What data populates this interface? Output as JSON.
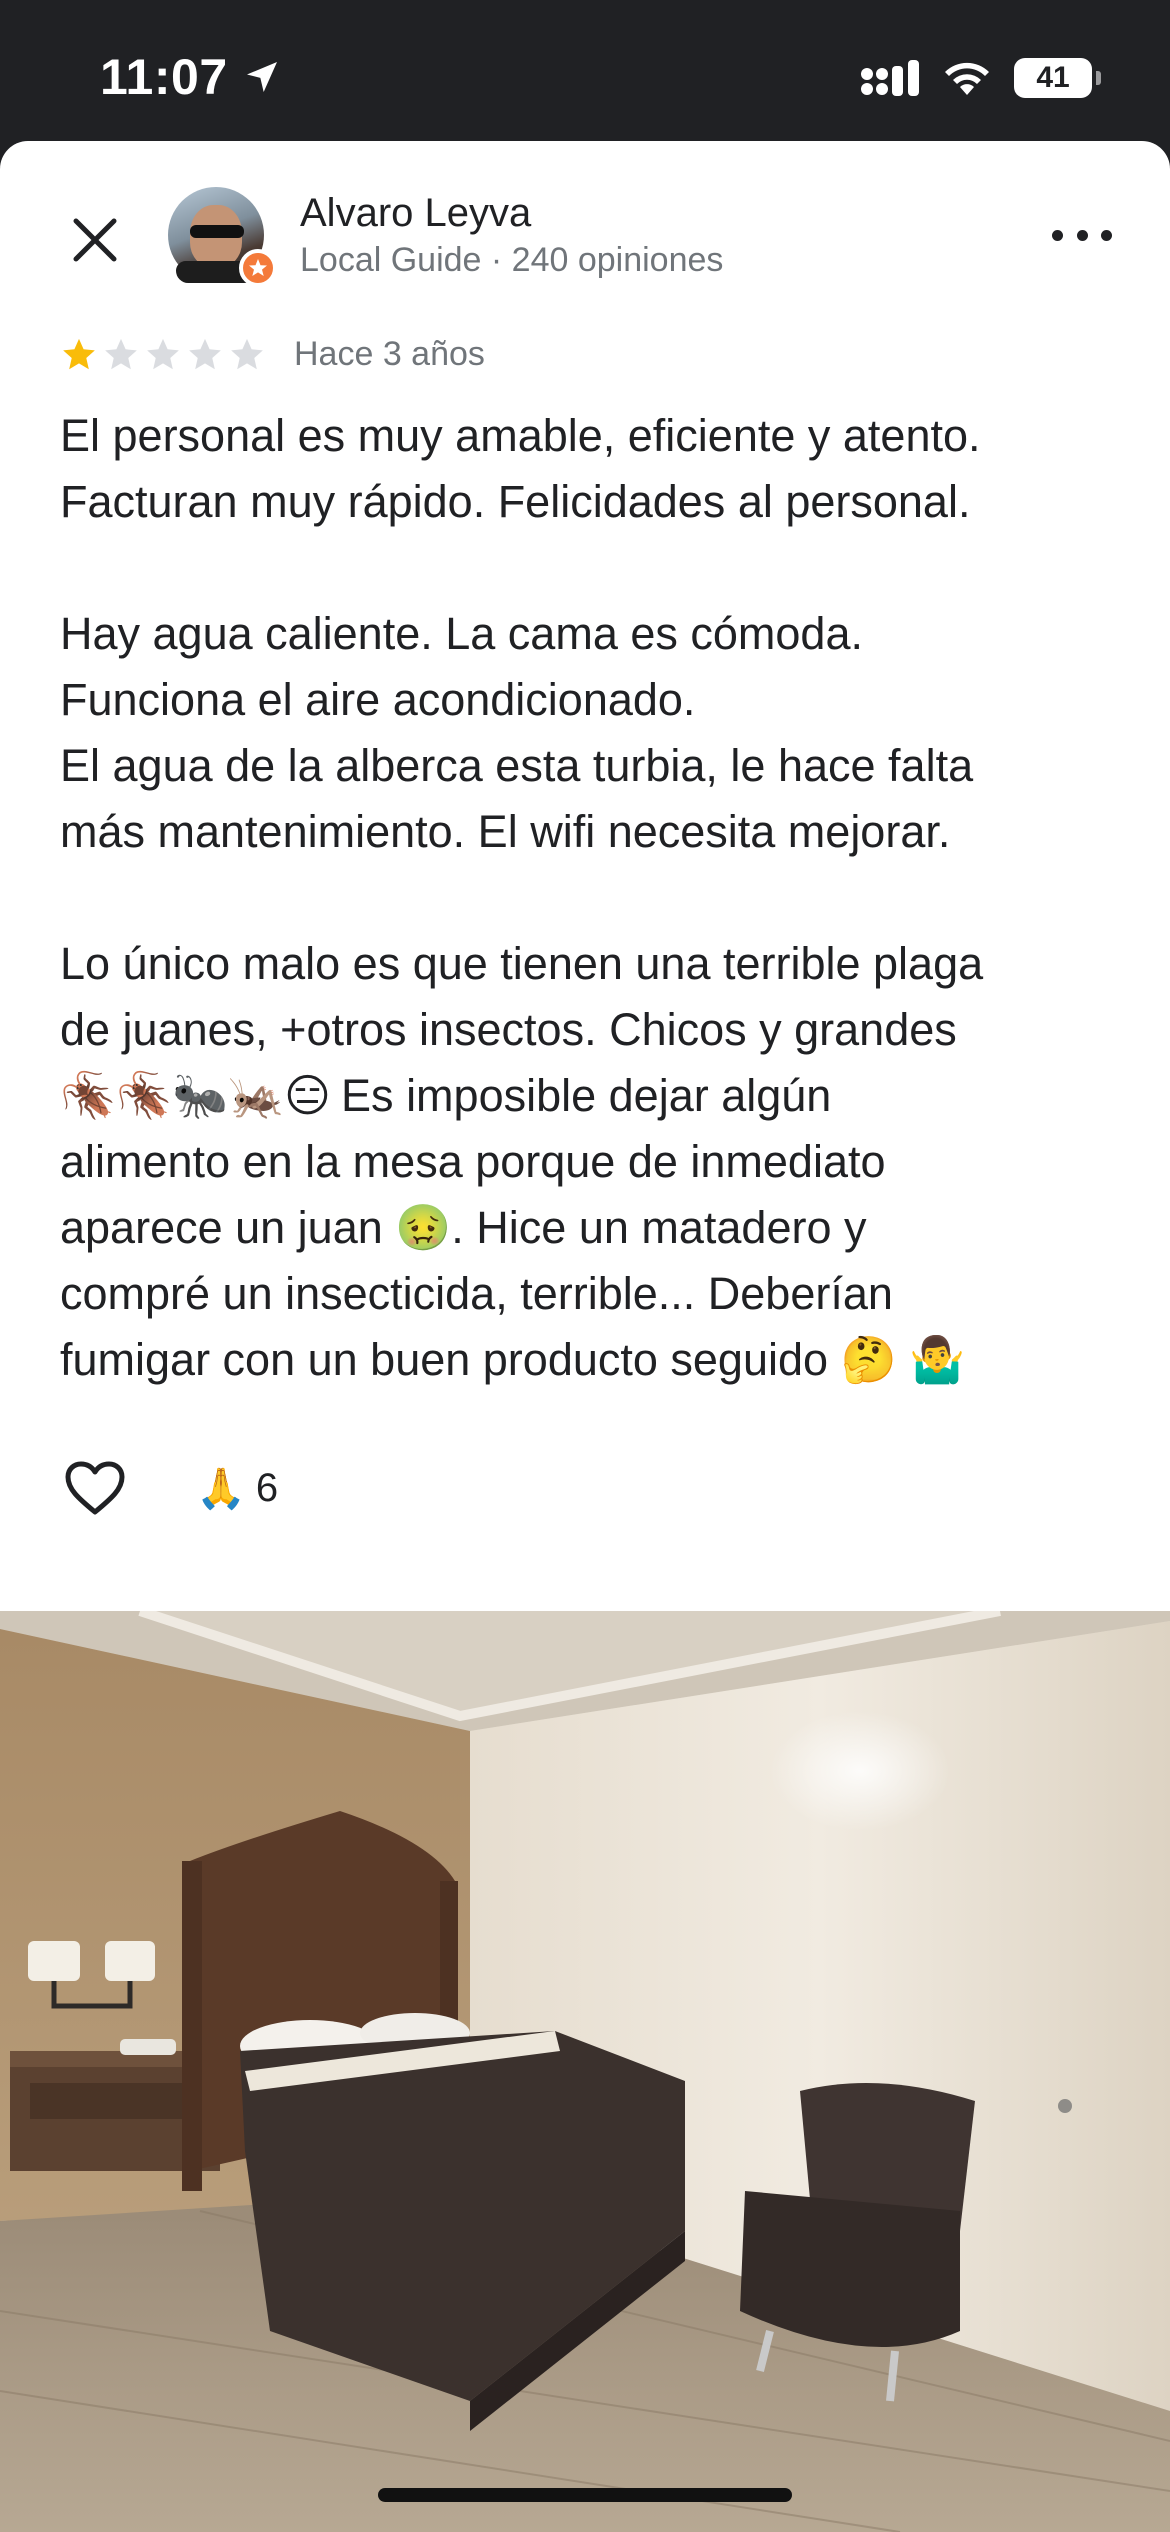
{
  "status_bar": {
    "time": "11:07",
    "battery": "41",
    "icons": [
      "location-arrow-icon",
      "cellular-signal-icon",
      "wifi-icon",
      "battery-icon"
    ]
  },
  "header": {
    "close_icon": "close-icon",
    "reviewer_name": "Alvaro Leyva",
    "reviewer_meta": "Local Guide · 240 opiniones",
    "more_icon": "more-options-icon"
  },
  "review": {
    "rating": 1,
    "max_rating": 5,
    "date": "Hace 3 años",
    "lines": [
      "El personal es muy amable, eficiente y atento.",
      "Facturan muy rápido. Felicidades al personal.",
      "",
      "Hay agua caliente. La cama es cómoda.",
      "Funciona el aire acondicionado.",
      "El agua de la alberca esta turbia, le hace falta",
      "más mantenimiento. El wifi necesita mejorar.",
      "",
      "Lo único malo es que tienen una terrible plaga",
      "de juanes, +otros insectos. Chicos y grandes"
    ],
    "emoji_line": {
      "emojis": "🪳🪳🐜🦗😑",
      "text": "Es imposible dejar algún"
    },
    "lines_after": [
      "alimento en la mesa porque de inmediato",
      "aparece un juan 🤢. Hice un matadero y",
      "compré un insecticida, terrible... Deberían",
      "fumigar con un buen producto seguido 🤔 🤷‍♂️"
    ]
  },
  "actions": {
    "like_icon": "heart-outline-icon",
    "reaction_emoji": "🙏",
    "reaction_count": "6"
  },
  "photo": {
    "subject": "hotel-room-photo"
  },
  "colors": {
    "star_filled": "#f9bc0a",
    "star_empty": "#dadce0",
    "text_primary": "#202124",
    "text_secondary": "#70757a",
    "status_bar_bg": "#202124",
    "badge": "#f47a3a"
  }
}
